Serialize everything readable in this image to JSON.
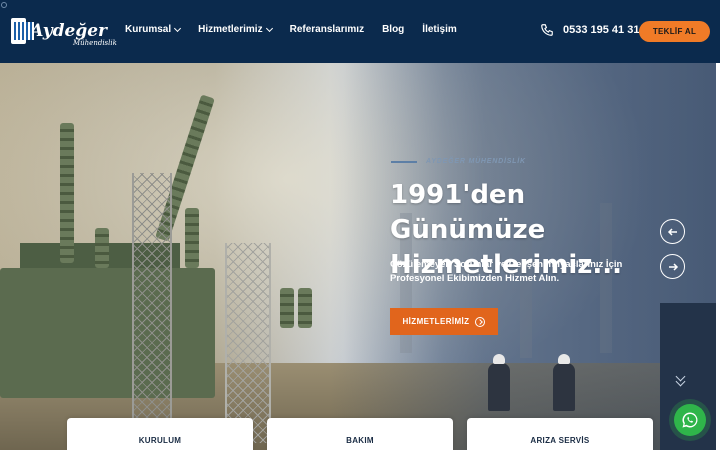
{
  "brand": {
    "name": "Aydeğer",
    "sub": "Mühendislik"
  },
  "nav": {
    "items": [
      {
        "label": "Kurumsal",
        "dropdown": true
      },
      {
        "label": "Hizmetlerimiz",
        "dropdown": true
      },
      {
        "label": "Referanslarımız",
        "dropdown": false
      },
      {
        "label": "Blog",
        "dropdown": false
      },
      {
        "label": "İletişim",
        "dropdown": false
      }
    ]
  },
  "contact": {
    "phone": "0533 195 41 31",
    "icon": "phone-icon"
  },
  "cta": {
    "label": "TEKLİF AL"
  },
  "hero": {
    "eyebrow": "AYDEĞER MÜHENDİSLİK",
    "title_line1": "1991'den Günümüze",
    "title_line2": "Hizmetlerimiz...",
    "subtitle_line1": "Çözülemeyen Sorunlar ve Gelişen İhtiyaçlarınız İçin",
    "subtitle_line2": "Profesyonel Ekibimizden Hizmet Alın.",
    "button_label": "HİZMETLERİMİZ",
    "prev_icon": "arrow-left-icon",
    "next_icon": "arrow-right-icon"
  },
  "services": [
    {
      "label": "KURULUM"
    },
    {
      "label": "BAKIM"
    },
    {
      "label": "ARIZA SERVİS"
    }
  ],
  "colors": {
    "header_bg": "#0b2a4d",
    "accent": "#f07b27",
    "hero_button": "#e1651c",
    "whatsapp": "#2fb54a"
  }
}
